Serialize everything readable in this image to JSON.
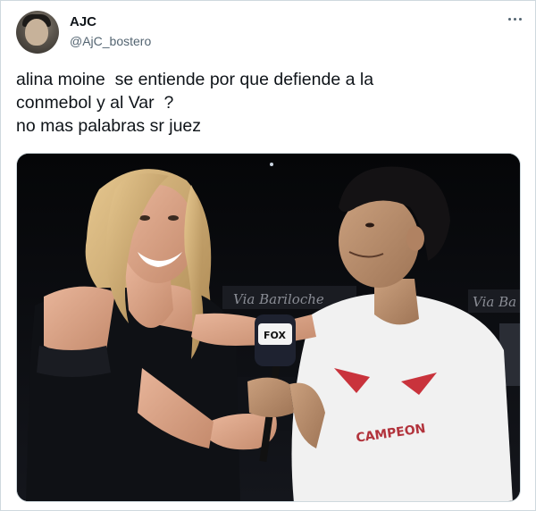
{
  "author": {
    "display_name": "AJC",
    "handle": "@AjC_bostero"
  },
  "tweet": {
    "text": "alina moine  se entiende por que defiende a la\nconmebol y al Var  ?\nno mas palabras sr juez"
  },
  "icons": {
    "more": "more-horizontal-icon",
    "avatar": "user-avatar"
  },
  "media": {
    "sign_left": "Via Bariloche",
    "sign_right": "Via Ba",
    "mic_logo": "FOX",
    "shirt_text": "CAMPEON"
  },
  "colors": {
    "text": "#0f1419",
    "secondary": "#536471",
    "border": "#cfd9de"
  }
}
